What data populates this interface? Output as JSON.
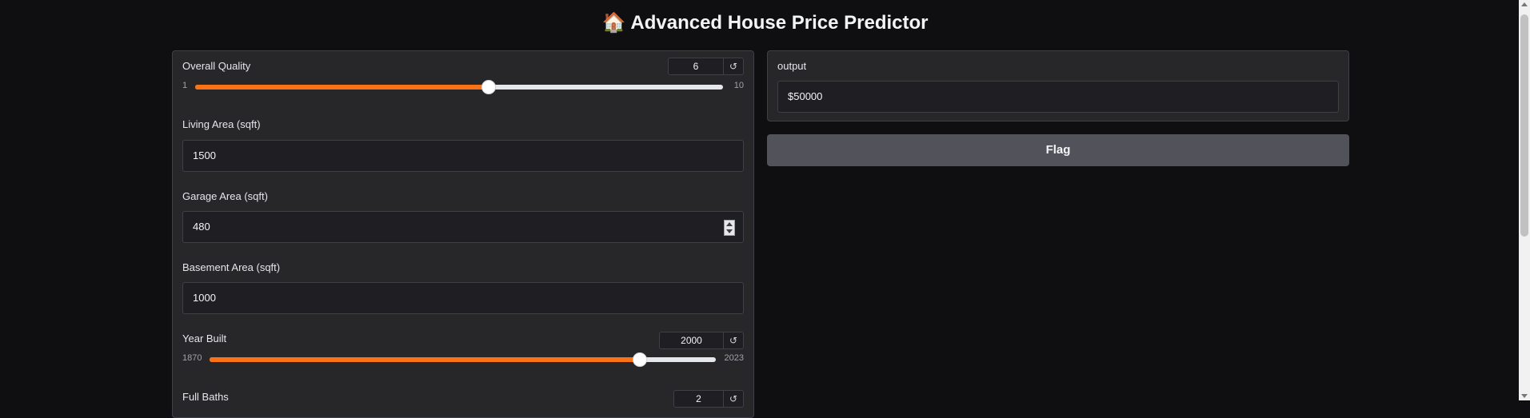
{
  "header": {
    "emoji": "🏠",
    "title": "Advanced House Price Predictor"
  },
  "inputs": {
    "overall_quality": {
      "label": "Overall Quality",
      "value": "6",
      "min": "1",
      "max": "10",
      "fraction": 0.5556
    },
    "living_area": {
      "label": "Living Area (sqft)",
      "value": "1500"
    },
    "garage_area": {
      "label": "Garage Area (sqft)",
      "value": "480"
    },
    "basement_area": {
      "label": "Basement Area (sqft)",
      "value": "1000"
    },
    "year_built": {
      "label": "Year Built",
      "value": "2000",
      "min": "1870",
      "max": "2023",
      "fraction": 0.8497
    },
    "full_baths": {
      "label": "Full Baths",
      "value": "2"
    }
  },
  "output": {
    "label": "output",
    "value": "$50000"
  },
  "actions": {
    "flag_label": "Flag"
  },
  "icons": {
    "reset": "reset-icon"
  },
  "colors": {
    "accent": "#f97316",
    "background": "#0f0f11",
    "panel": "#27272a",
    "button": "#52525b"
  }
}
